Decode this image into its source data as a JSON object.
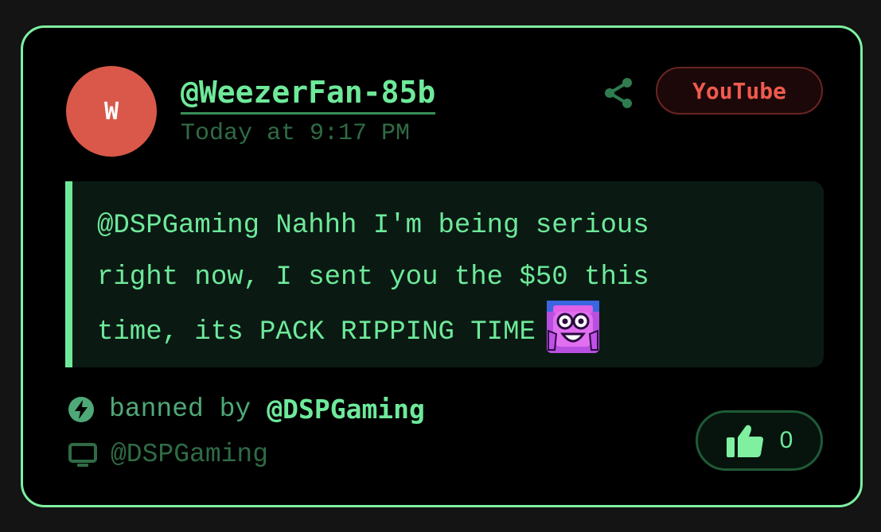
{
  "card": {
    "avatar_initial": "W",
    "username": "@WeezerFan-85b",
    "timestamp": "Today at 9:17 PM",
    "platform_badge": "YouTube",
    "message": {
      "line1": "@DSPGaming Nahhh I'm being serious",
      "line2": "right now, I sent you the $50 this",
      "line3": "time, its PACK RIPPING TIME"
    },
    "ban_label": "banned by",
    "ban_by": "@DSPGaming",
    "channel": "@DSPGaming",
    "like_count": "0"
  },
  "icons": {
    "share": "share-icon",
    "bolt": "lightning-bolt-icon",
    "tv": "tv-icon",
    "thumbs_up": "thumbs-up-icon",
    "emote": "surprised-face-emote"
  },
  "colors": {
    "accent": "#6ee99a",
    "border": "#7ef0a0",
    "badge_red": "#ef5a4f",
    "avatar_bg": "#d9584a",
    "muted_green": "#2f6b45"
  }
}
